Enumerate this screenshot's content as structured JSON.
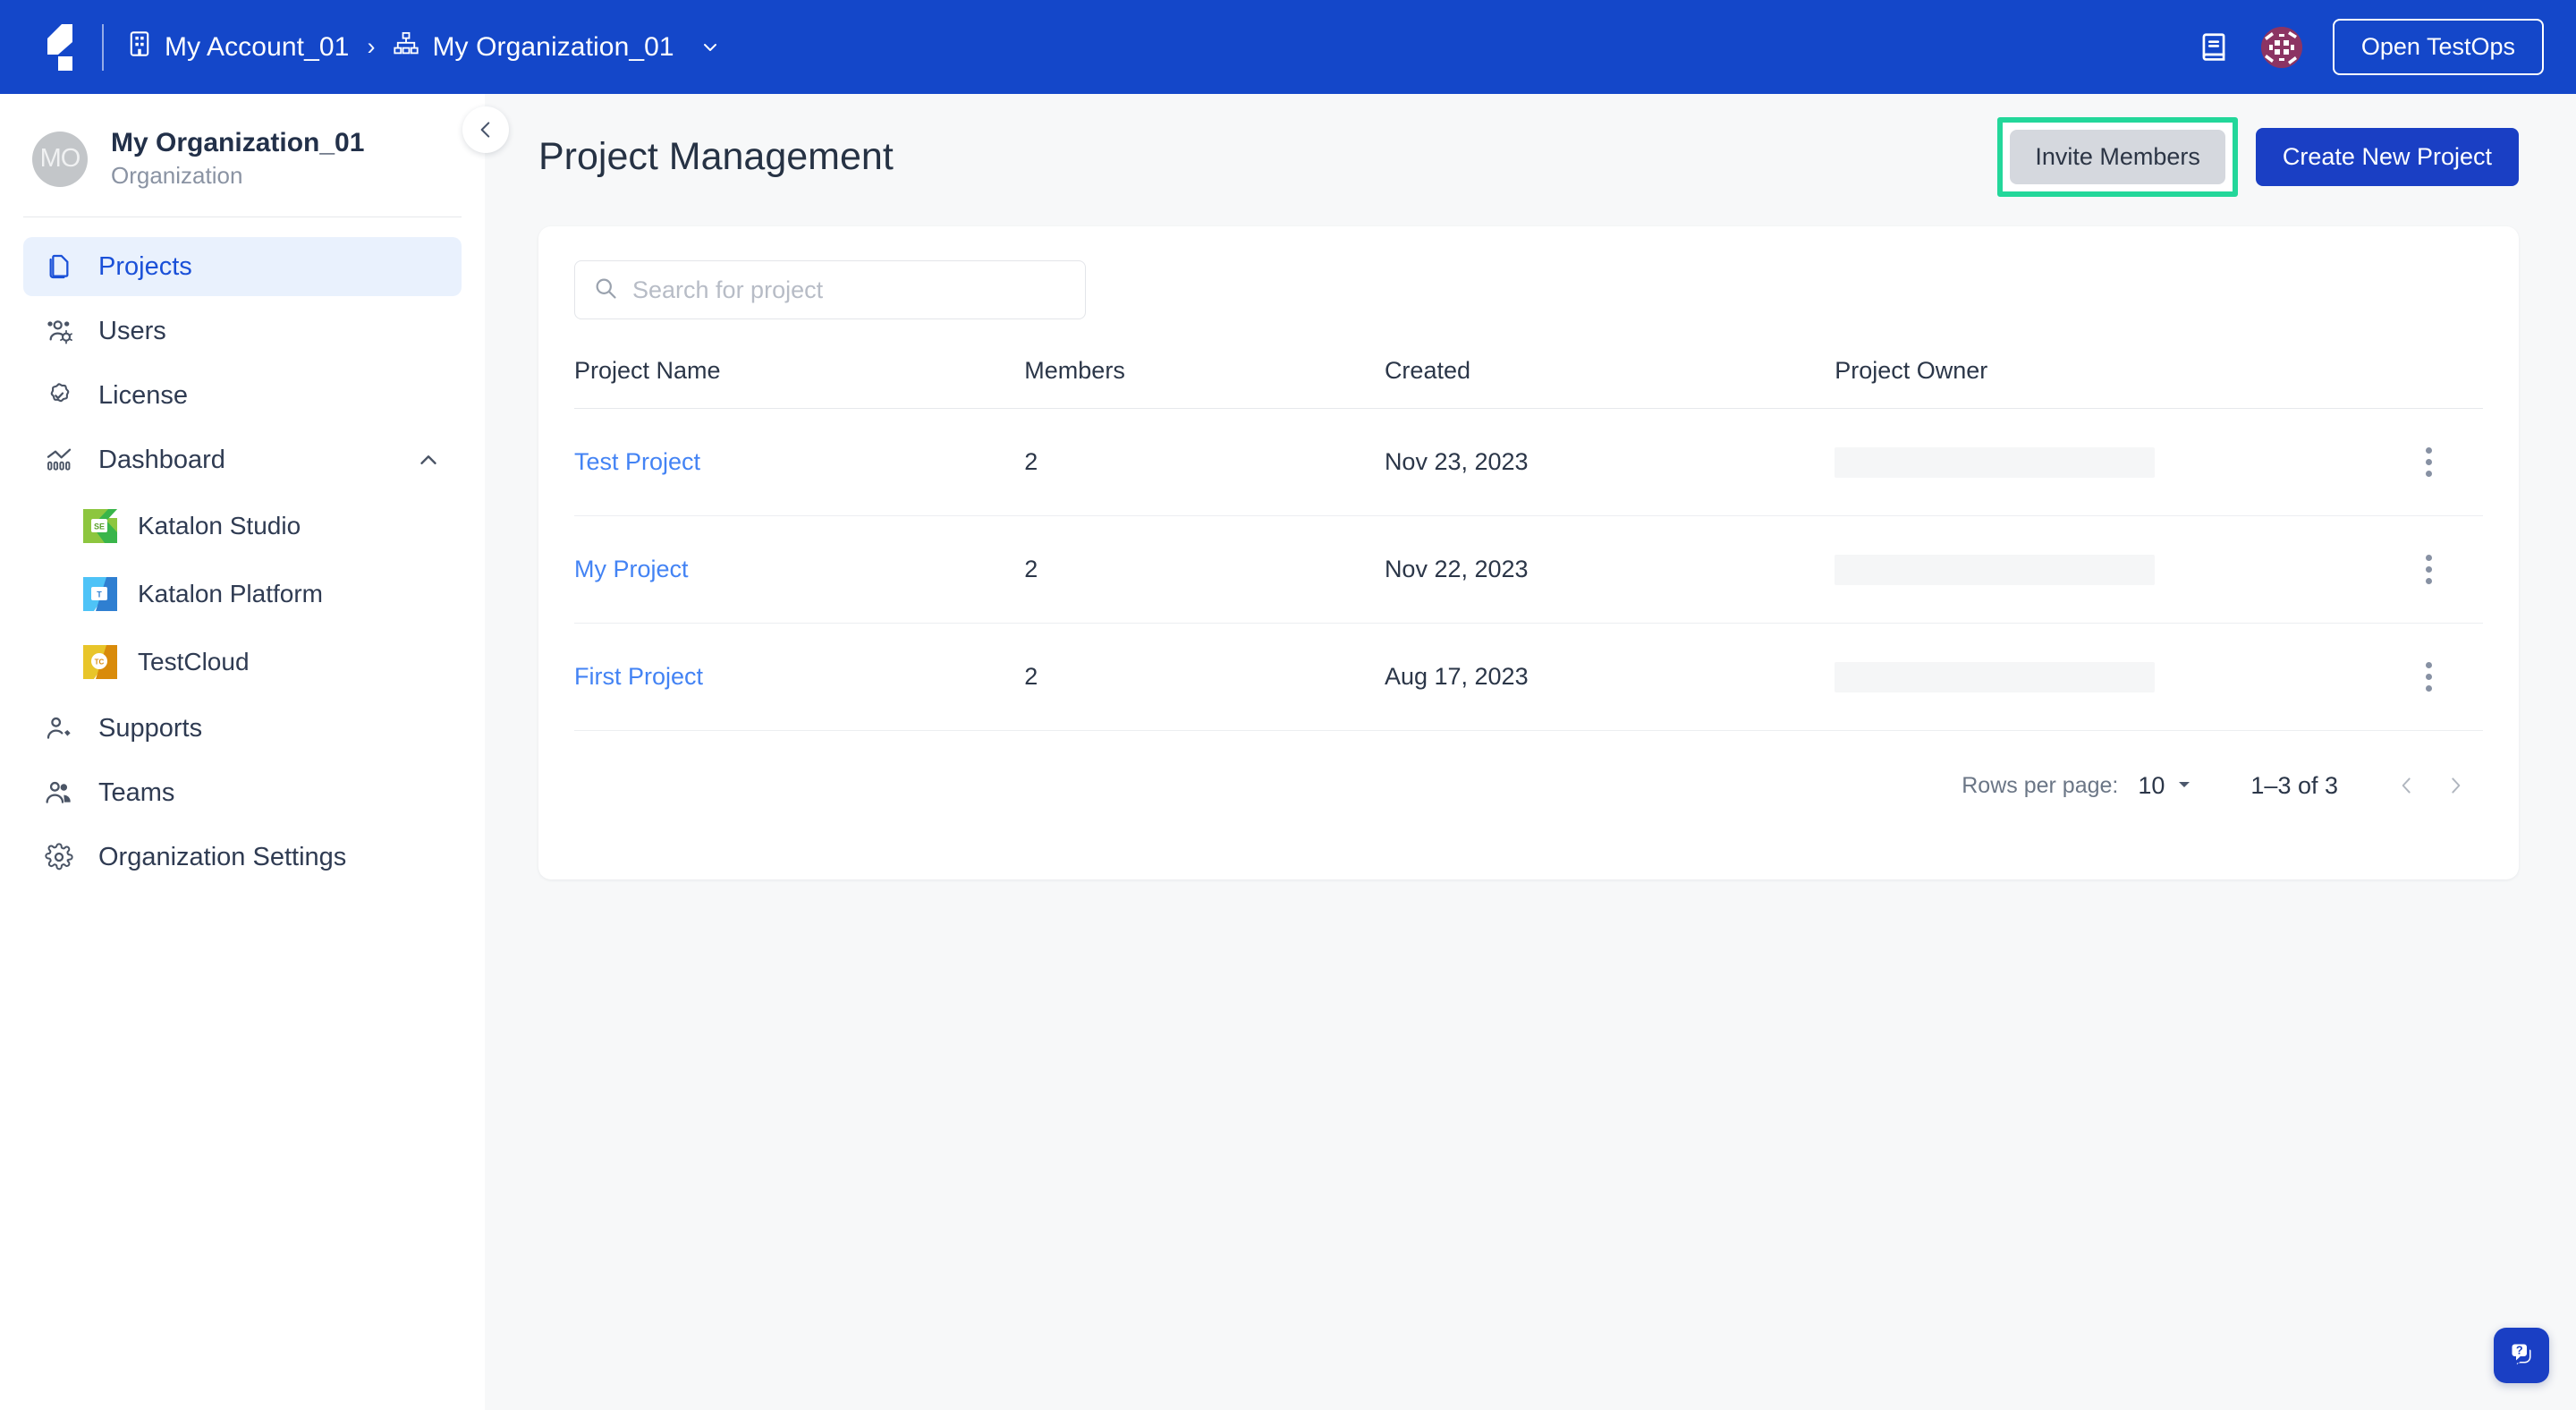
{
  "topbar": {
    "logo_name": "katalon-logo",
    "breadcrumbs": [
      {
        "label": "My Account_01",
        "icon": "building-icon"
      },
      {
        "label": "My Organization_01",
        "icon": "org-chart-icon"
      }
    ],
    "separator": "›",
    "docs_icon": "book-icon",
    "avatar_icon": "user-avatar-identicon",
    "open_testops_label": "Open TestOps",
    "bg_color": "#1447c9"
  },
  "sidebar": {
    "org_initials": "MO",
    "org_name": "My Organization_01",
    "org_subtitle": "Organization",
    "items": [
      {
        "label": "Projects",
        "icon": "copy-documents-icon",
        "active": true
      },
      {
        "label": "Users",
        "icon": "users-settings-icon",
        "active": false
      },
      {
        "label": "License",
        "icon": "badge-check-icon",
        "active": false
      },
      {
        "label": "Dashboard",
        "icon": "analytics-chart-icon",
        "active": false,
        "expanded": true
      }
    ],
    "dashboard_children": [
      {
        "label": "Katalon Studio",
        "icon": "katalon-studio-icon"
      },
      {
        "label": "Katalon Platform",
        "icon": "katalon-platform-icon"
      },
      {
        "label": "TestCloud",
        "icon": "testcloud-icon"
      }
    ],
    "items_bottom": [
      {
        "label": "Supports",
        "icon": "user-tag-icon"
      },
      {
        "label": "Teams",
        "icon": "teams-icon"
      },
      {
        "label": "Organization Settings",
        "icon": "gear-icon"
      }
    ],
    "collapse_icon": "chevron-left-icon",
    "active_color": "#1a50d8",
    "active_bg": "#e9f1fd"
  },
  "page": {
    "title": "Project Management",
    "invite_members_label": "Invite Members",
    "create_project_label": "Create New Project",
    "highlight_color": "#23d79a",
    "primary_color": "#1a3fc4"
  },
  "search": {
    "placeholder": "Search for project",
    "value": "",
    "icon": "search-icon"
  },
  "table": {
    "columns": [
      "Project Name",
      "Members",
      "Created",
      "Project Owner",
      ""
    ],
    "rows": [
      {
        "name": "Test Project",
        "members": "2",
        "created": "Nov 23, 2023",
        "owner": "",
        "menu_icon": "kebab-menu-icon"
      },
      {
        "name": "My Project",
        "members": "2",
        "created": "Nov 22, 2023",
        "owner": "",
        "menu_icon": "kebab-menu-icon"
      },
      {
        "name": "First Project",
        "members": "2",
        "created": "Aug 17, 2023",
        "owner": "",
        "menu_icon": "kebab-menu-icon"
      }
    ],
    "link_color": "#4383f4"
  },
  "pagination": {
    "rows_per_page_label": "Rows per page:",
    "rows_per_page_value": "10",
    "range_label": "1–3 of 3",
    "prev_icon": "chevron-left-icon",
    "next_icon": "chevron-right-icon",
    "dropdown_icon": "caret-down-icon"
  },
  "help": {
    "icon": "help-chat-icon",
    "color": "#1a3fc4"
  }
}
